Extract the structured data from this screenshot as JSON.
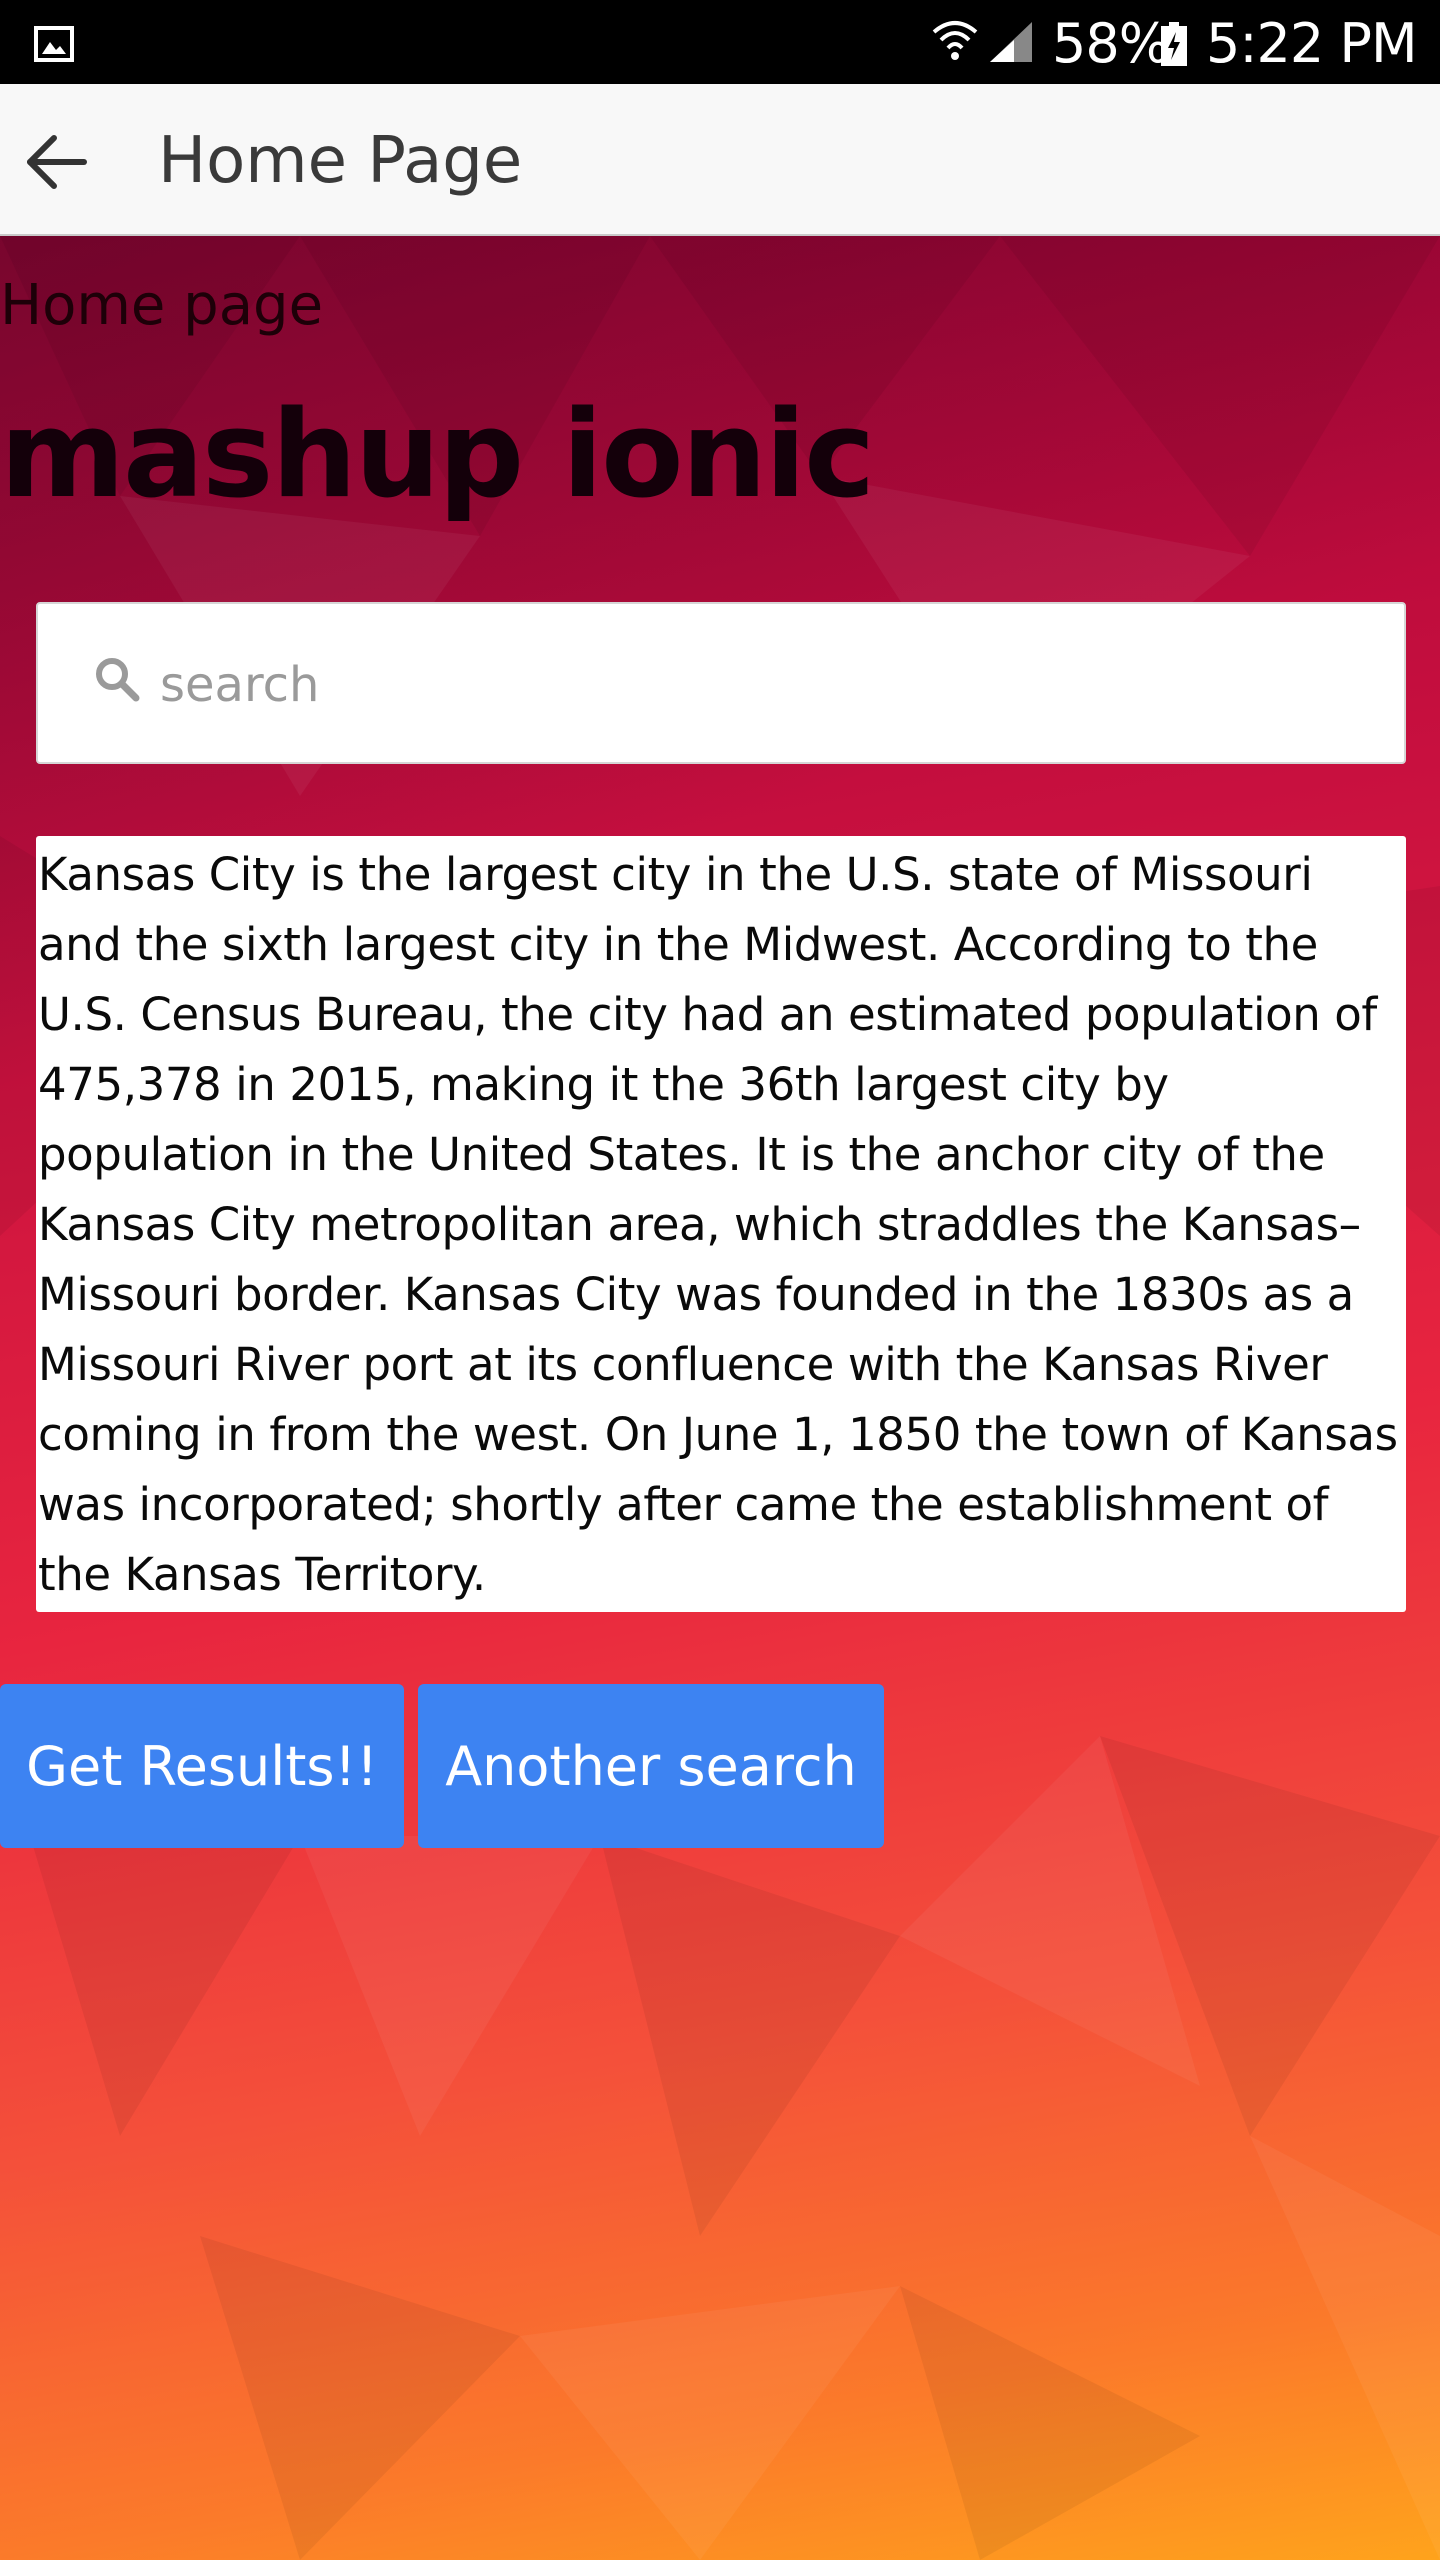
{
  "status_bar": {
    "battery_percent": "58%",
    "time": "5:22 PM",
    "icons": [
      "gallery-icon",
      "wifi-icon",
      "signal-icon",
      "battery-charging-icon"
    ]
  },
  "header": {
    "back_icon": "arrow-left-icon",
    "title": "Home Page"
  },
  "main": {
    "subheading": "Home page",
    "title": "mashup ionic",
    "search": {
      "icon": "search-icon",
      "placeholder": "search",
      "value": ""
    },
    "description": "Kansas City is the largest city in the U.S. state of Missouri and the sixth largest city in the Midwest. According to the U.S. Census Bureau, the city had an estimated population of 475,378 in 2015, making it the 36th largest city by population in the United States. It is the anchor city of the Kansas City metropolitan area, which straddles the Kansas–Missouri border. Kansas City was founded in the 1830s as a Missouri River port at its confluence with the Kansas River coming in from the west. On June 1, 1850 the town of Kansas was incorporated; shortly after came the establishment of the Kansas Territory.",
    "buttons": {
      "get_results": "Get Results!!",
      "another_search": "Another search"
    }
  },
  "colors": {
    "button": "#3d83f2",
    "background_top": "#9e0035",
    "background_bottom": "#ffa31c",
    "header_bg": "#f8f8f8"
  }
}
